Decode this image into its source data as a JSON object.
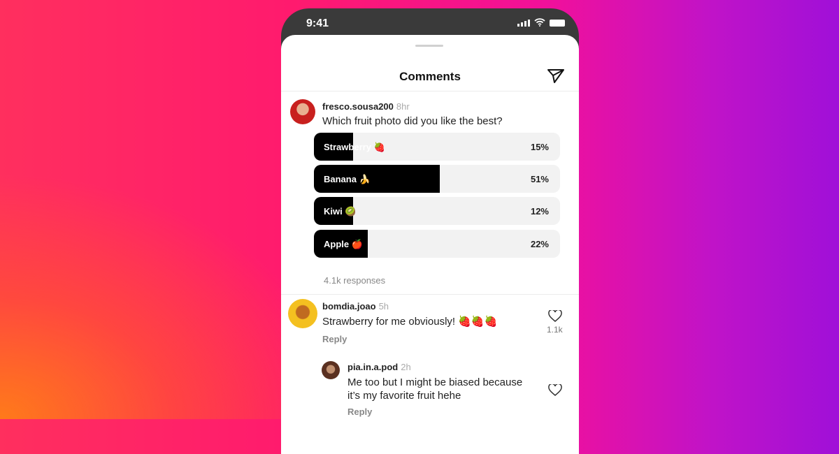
{
  "status_bar": {
    "time": "9:41"
  },
  "header": {
    "title": "Comments"
  },
  "post": {
    "username": "fresco.sousa200",
    "time": "8hr",
    "question": "Which fruit photo did you like the best?",
    "options": [
      {
        "label": "Strawberry 🍓",
        "percent": 15,
        "percent_label": "15%"
      },
      {
        "label": "Banana 🍌",
        "percent": 51,
        "percent_label": "51%"
      },
      {
        "label": "Kiwi 🥝",
        "percent": 12,
        "percent_label": "12%"
      },
      {
        "label": "Apple 🍎",
        "percent": 22,
        "percent_label": "22%"
      }
    ],
    "responses": "4.1k responses"
  },
  "comments": [
    {
      "username": "bomdia.joao",
      "time": "5h",
      "text": "Strawberry for me obviously! 🍓🍓🍓",
      "likes": "1.1k",
      "reply": "Reply"
    },
    {
      "username": "pia.in.a.pod",
      "time": "2h",
      "text": "Me too but I might be biased because it’s my favorite fruit hehe",
      "reply": "Reply"
    }
  ]
}
